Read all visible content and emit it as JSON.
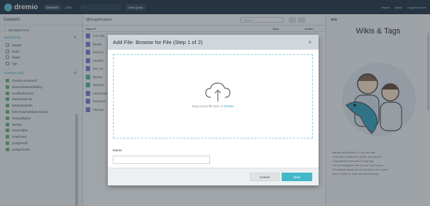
{
  "topbar": {
    "logo": "dremio",
    "tabs": [
      "Datasets",
      "Jobs"
    ],
    "new_query": "New Query",
    "right": [
      "Help ▾",
      "Admin",
      "lungaSource ▾"
    ]
  },
  "left": {
    "header": "Datasets",
    "home": "@lungaSource",
    "spaces_title": "Spaces (4)",
    "spaces": [
      "Supper",
      "inpho",
      "sagas",
      "nge"
    ],
    "sources_title": "Sources (32)",
    "sources": [
      {
        "name": "chenilluconSearch",
        "count": ""
      },
      {
        "name": "doxmechasPublishing",
        "count": ""
      },
      {
        "name": "Health3Search1",
        "count": ""
      },
      {
        "name": "ElasticSearch5",
        "count": ""
      },
      {
        "name": "ElasticSearch6",
        "count": ""
      },
      {
        "name": "hdtnemaentsElasticSearch",
        "count": ""
      },
      {
        "name": "Mongodbprox",
        "count": ""
      },
      {
        "name": "MySQL",
        "count": ""
      },
      {
        "name": "oracleTable",
        "count": ""
      },
      {
        "name": "OracleTest",
        "count": ""
      },
      {
        "name": "postgresOF",
        "count": ""
      },
      {
        "name": "postgresVDS",
        "count": ""
      }
    ]
  },
  "main": {
    "breadcrumb": "@lungaSource",
    "search_placeholder": "Search...",
    "columns": {
      "name": "Name ▾",
      "jobs": "Jobs",
      "action": "Action"
    },
    "rows": [
      {
        "name": "Fun-Test",
        "type": "virtual"
      },
      {
        "name": "file200",
        "type": "virtual"
      },
      {
        "name": "fund112",
        "type": "virtual"
      },
      {
        "name": "Health3",
        "type": "virtual"
      },
      {
        "name": "json_ac",
        "type": "virtual"
      },
      {
        "name": "MySQL",
        "type": "physical"
      },
      {
        "name": "MySQL2",
        "type": "physical"
      },
      {
        "name": "Uniteamos",
        "type": "virtual"
      },
      {
        "name": "Oaklands",
        "type": "virtual"
      },
      {
        "name": "Startups",
        "type": "virtual"
      }
    ]
  },
  "wiki": {
    "label": "Wiki",
    "title": "Wikis & Tags",
    "lines": [
      "Starting with Dremio 3.0, you can now:",
      "• Add wikis to datasets, spaces and sources",
      "• Tag datasets and search using tags",
      "",
      "You are reading the wiki for your home space.",
      "This sidebar always shows the wiki for the current",
      "source, space or folder you are browsing."
    ]
  },
  "modal": {
    "title": "Add File: Browse for File (Step 1 of 2)",
    "close": "×",
    "drop_text": "Drop a local file here, or ",
    "browse": "browse",
    "name_label": "Name",
    "name_value": "",
    "cancel": "Cancel",
    "next": "Next"
  },
  "colors": {
    "accent": "#43b8c9",
    "topbar": "#2a3a4a",
    "browse_link": "#2b9ed6"
  }
}
